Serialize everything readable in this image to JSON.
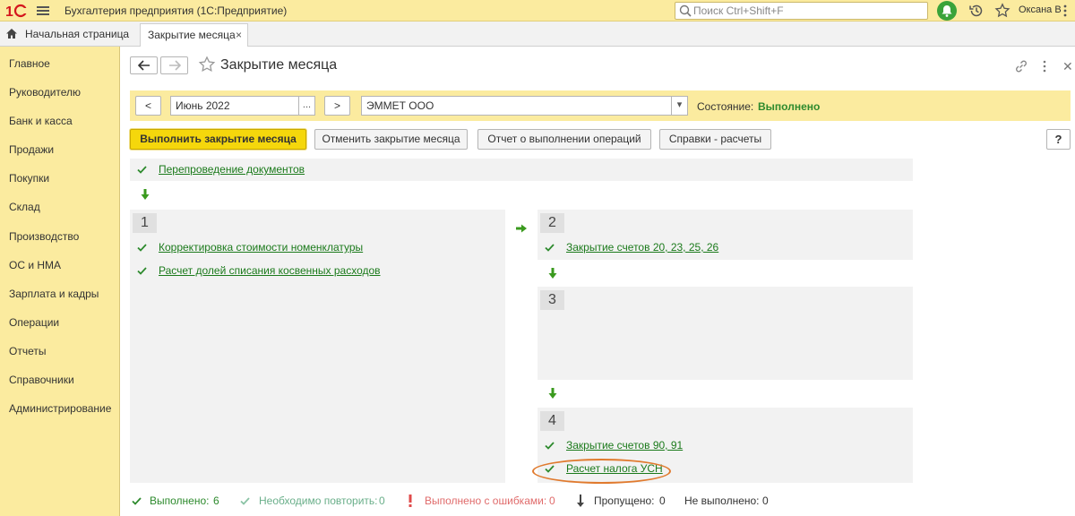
{
  "titlebar": {
    "app_title": "Бухгалтерия предприятия  (1С:Предприятие)",
    "search_placeholder": "Поиск Ctrl+Shift+F",
    "user": "Оксана В"
  },
  "tabs": {
    "home": "Начальная страница",
    "active": "Закрытие месяца",
    "close": "×"
  },
  "sidebar": {
    "items": [
      "Главное",
      "Руководителю",
      "Банк и касса",
      "Продажи",
      "Покупки",
      "Склад",
      "Производство",
      "ОС и НМА",
      "Зарплата и кадры",
      "Операции",
      "Отчеты",
      "Справочники",
      "Администрирование"
    ]
  },
  "page": {
    "title": "Закрытие месяца",
    "period_prev": "<",
    "period": "Июнь 2022",
    "period_select": "...",
    "period_next": ">",
    "organization": "ЭММЕТ ООО",
    "org_dropdown": "▾",
    "state_label": "Состояние:",
    "state_value": "Выполнено"
  },
  "actions": {
    "execute": "Выполнить закрытие месяца",
    "cancel": "Отменить закрытие месяца",
    "report": "Отчет о выполнении операций",
    "references": "Справки - расчеты",
    "help": "?"
  },
  "steps": {
    "prelim": {
      "op": "Перепроведение документов"
    },
    "step1": {
      "num": "1",
      "ops": [
        "Корректировка стоимости номенклатуры",
        "Расчет долей списания косвенных расходов"
      ]
    },
    "step2": {
      "num": "2",
      "ops": [
        "Закрытие счетов 20, 23, 25, 26"
      ]
    },
    "step3": {
      "num": "3",
      "ops": []
    },
    "step4": {
      "num": "4",
      "ops": [
        "Закрытие счетов 90, 91",
        "Расчет налога УСН"
      ]
    }
  },
  "status": {
    "done_label": "Выполнено:",
    "done_count": "6",
    "repeat_label": "Необходимо повторить:",
    "repeat_count": "0",
    "errors_label": "Выполнено с ошибками:",
    "errors_count": "0",
    "skipped_label": "Пропущено:",
    "skipped_count": "0",
    "notdone_label": "Не выполнено:",
    "notdone_count": "0"
  },
  "colors": {
    "accent_yellow": "#fbeb9f",
    "primary_button": "#f5d70c",
    "success_green": "#2d8a2d",
    "error_red": "#e04b4b",
    "highlight_orange": "#e07a2e"
  }
}
